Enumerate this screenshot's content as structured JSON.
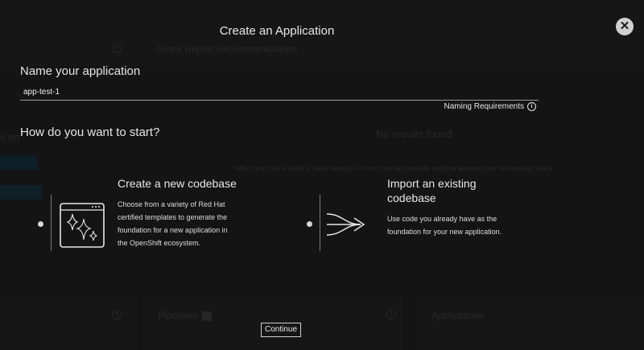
{
  "background": {
    "stack_report_title": "Stack Report Recommendations",
    "no_results_title": "No results found",
    "no_results_desc": "When you run a build, a stack analysis is run that will provide insights around your technology stack.",
    "left_snippet": "s no",
    "pipelines_title": "Pipelines",
    "applications_title": "Applications"
  },
  "modal": {
    "title": "Create an Application",
    "name_label": "Name your application",
    "name_value": "app-test-1",
    "naming_requirements": "Naming Requirements",
    "start_label": "How do you want to start?",
    "options": [
      {
        "title": "Create a new codebase",
        "description_lines": [
          "Choose from a variety of Red Hat",
          "certified templates to generate the",
          "foundation for a new application in",
          "the OpenShift ecosystem."
        ]
      },
      {
        "title_lines": [
          "Import an existing",
          "codebase"
        ],
        "description_lines": [
          "Use code you already have as the",
          "foundation for your new application."
        ]
      }
    ],
    "continue_label": "Continue",
    "close_glyph": "✕"
  }
}
